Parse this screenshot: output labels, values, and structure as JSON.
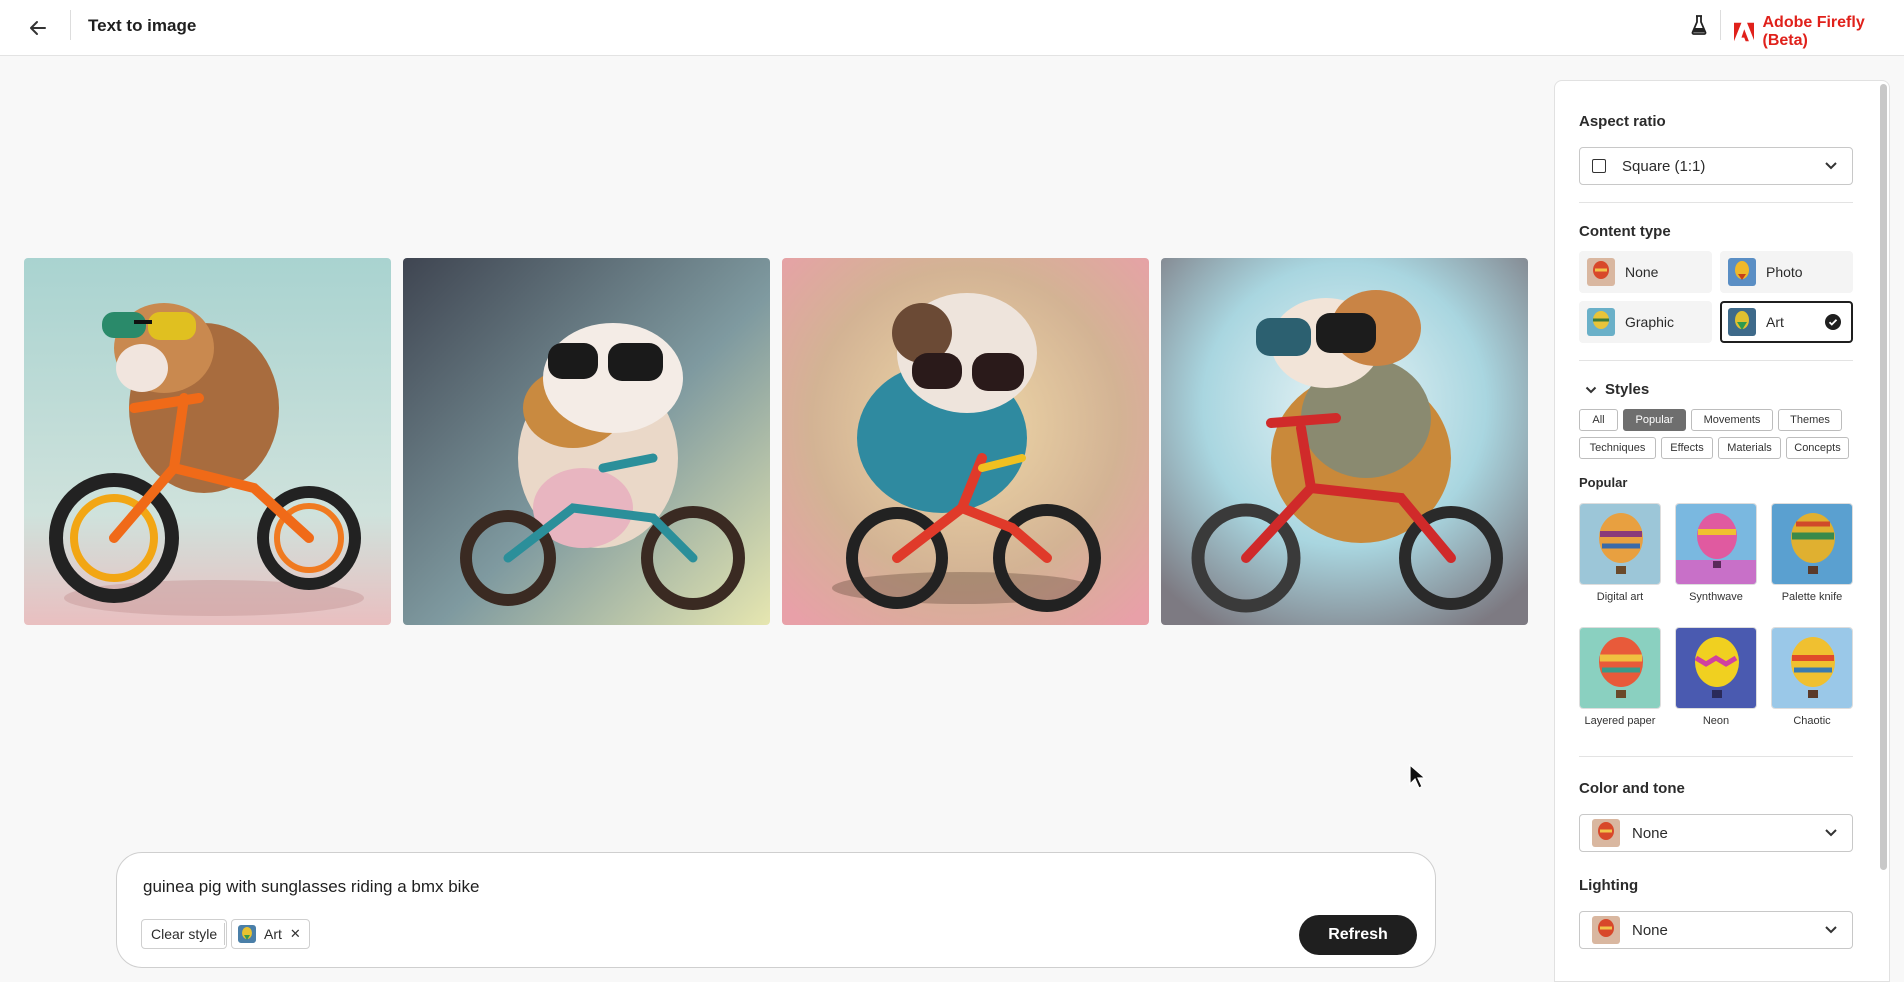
{
  "header": {
    "title": "Text to image",
    "brand": "Adobe Firefly (Beta)"
  },
  "gallery": {
    "images": [
      "guinea-pig-image-1",
      "guinea-pig-image-2",
      "guinea-pig-image-3",
      "guinea-pig-image-4"
    ]
  },
  "prompt": {
    "text": "guinea pig with sunglasses riding a bmx bike",
    "clear_style_label": "Clear style",
    "style_chip_label": "Art",
    "refresh_label": "Refresh"
  },
  "panel": {
    "aspect_ratio": {
      "label": "Aspect ratio",
      "value": "Square (1:1)"
    },
    "content_type": {
      "label": "Content type",
      "options": [
        {
          "label": "None",
          "selected": false
        },
        {
          "label": "Photo",
          "selected": false
        },
        {
          "label": "Graphic",
          "selected": false
        },
        {
          "label": "Art",
          "selected": true
        }
      ]
    },
    "styles": {
      "label": "Styles",
      "filters": [
        {
          "label": "All",
          "active": false
        },
        {
          "label": "Popular",
          "active": true
        },
        {
          "label": "Movements",
          "active": false
        },
        {
          "label": "Themes",
          "active": false
        },
        {
          "label": "Techniques",
          "active": false
        },
        {
          "label": "Effects",
          "active": false
        },
        {
          "label": "Materials",
          "active": false
        },
        {
          "label": "Concepts",
          "active": false
        }
      ],
      "section_label": "Popular",
      "items": [
        {
          "label": "Digital art"
        },
        {
          "label": "Synthwave"
        },
        {
          "label": "Palette knife"
        },
        {
          "label": "Layered paper"
        },
        {
          "label": "Neon"
        },
        {
          "label": "Chaotic"
        }
      ]
    },
    "color_and_tone": {
      "label": "Color and tone",
      "value": "None"
    },
    "lighting": {
      "label": "Lighting",
      "value": "None"
    }
  },
  "colors": {
    "brand_red": "#e0211b",
    "accent_dark": "#1f1f1f"
  }
}
